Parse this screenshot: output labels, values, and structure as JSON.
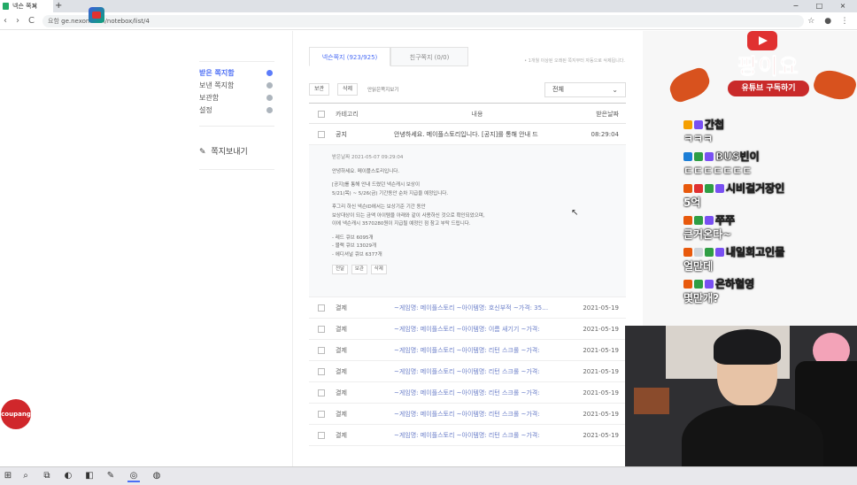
{
  "browser": {
    "tab_title": "넥슨 쪽지",
    "tab_close": "×",
    "tab_new": "+",
    "url_prefix": "요함",
    "url": "ge.nexon.com/notebox/list/4",
    "controls": {
      "back": "‹",
      "forward": "›",
      "reload": "C",
      "minimize": "−",
      "maximize": "□",
      "close": "×"
    }
  },
  "sidebar": {
    "items": [
      {
        "label": "받은 쪽지함"
      },
      {
        "label": "보낸 쪽지함"
      },
      {
        "label": "보관함"
      },
      {
        "label": "설정"
      }
    ],
    "send_label": "쪽지보내기",
    "pen_icon": "✎"
  },
  "content": {
    "tabs": [
      {
        "label": "넥슨쪽지 (923/925)"
      },
      {
        "label": "친구쪽지 (0/0)"
      }
    ],
    "tab_note": "• 1개월 이상된 오래된 쪽지부터 자동으로 삭제됩니다.",
    "toolbar": {
      "keep_label": "보관",
      "delete_label": "삭제",
      "helper_label": "안읽은쪽지보기",
      "filter_value": "전체",
      "chevron": "⌄"
    },
    "table": {
      "headers": {
        "category": "카테고리",
        "body": "내용",
        "date": "받은날짜"
      },
      "notice": {
        "category": "공지",
        "body": "안녕하세요. 메이플스토리입니다. [공지]를 통해 안내 드",
        "date": "08:29:04"
      },
      "expanded": {
        "meta": "받은날짜   2021-05-07 09:29:04",
        "p1": "안녕하세요. 메이플스토리입니다.",
        "p2a": "[공지]를 통해 안내 드렸던 넥슨캐시 보상이",
        "p2b": "5/21(목) ~ 5/26(금) 기간동안 순차 지급을 예정입니다.",
        "p3a": "후그리 하신 넥슨ID에서는 보상기준 기간 동안",
        "p3b": "보상대상이 되는 금액 아이템을 아래와 같이 사용하신 것으로 확인되었으며,",
        "p3c": "이에 넥슨캐시 3570280원이 지급될 예정인 점 참고 부탁 드립니다.",
        "l1": "- 레드 큐브 6095개",
        "l2": "- 블랙 큐브 13029개",
        "l3": "- 에디셔널 큐브 6377개",
        "btn1": "전달",
        "btn2": "보관",
        "btn3": "삭제"
      },
      "rows": [
        {
          "category": "결제",
          "body": "~게임명: 메이플스토리 ~아이템명: 호신부적 ~가격: 35…",
          "date": "2021-05-19"
        },
        {
          "category": "결제",
          "body": "~게임명: 메이플스토리 ~아이템명: 이름 새기기 ~가격:",
          "date": "2021-05-19"
        },
        {
          "category": "결제",
          "body": "~게임명: 메이플스토리 ~아이템명: 리턴 스크롤 ~가격:",
          "date": "2021-05-19"
        },
        {
          "category": "결제",
          "body": "~게임명: 메이플스토리 ~아이템명: 리턴 스크롤 ~가격:",
          "date": "2021-05-19"
        },
        {
          "category": "결제",
          "body": "~게임명: 메이플스토리 ~아이템명: 리턴 스크롤 ~가격:",
          "date": "2021-05-19"
        },
        {
          "category": "결제",
          "body": "~게임명: 메이플스토리 ~아이템명: 리턴 스크롤 ~가격:",
          "date": "2021-05-19"
        },
        {
          "category": "결제",
          "body": "~게임명: 메이플스토리 ~아이템명: 리턴 스크롤 ~가격:",
          "date": "2021-05-19"
        }
      ]
    }
  },
  "coupang": {
    "label": "coupang"
  },
  "stream": {
    "title": "팡이요",
    "subscribe": "유튜브 구독하기",
    "chat": [
      {
        "name": "간첩",
        "text": "ㅋㅋㅋ"
      },
      {
        "name": "BUS빈이",
        "text": "ㄷㄷㄷㄷㄷㄷㄷ"
      },
      {
        "name": "시비걸거장인",
        "text": "5억"
      },
      {
        "name": "쭈쭈",
        "text": "큰거온다~"
      },
      {
        "name": "내일회고인물",
        "text": "얼만데"
      },
      {
        "name": "은하혈영",
        "text": "몇만개?"
      }
    ]
  },
  "taskbar": {
    "icons": [
      "⊞",
      "⌕",
      "⧉",
      "◐",
      "◧",
      "✎",
      "◎",
      "◍"
    ]
  },
  "colors": {
    "accent": "#4c6ef5",
    "youtube_red": "#c92a2a"
  }
}
